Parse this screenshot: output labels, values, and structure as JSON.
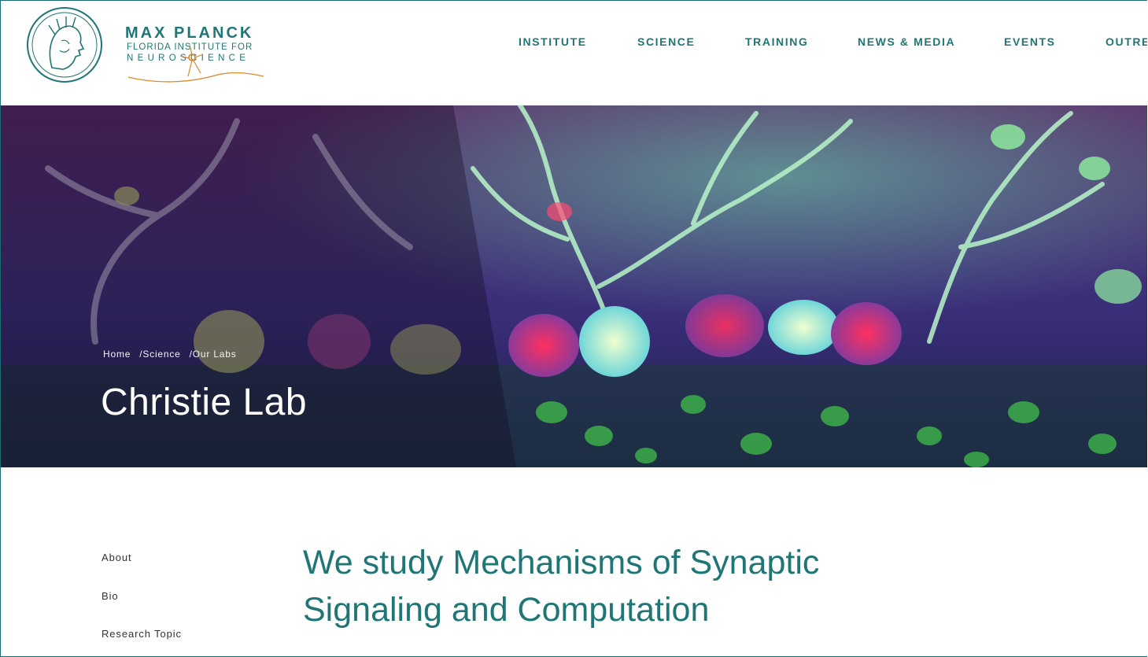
{
  "brand": {
    "title": "MAX PLANCK",
    "subtitle_line1": "FLORIDA INSTITUTE FOR",
    "subtitle_line2": "NEUROSCIENCE",
    "seal_icon": "minerva-seal-icon",
    "neuron_icon": "neuron-icon"
  },
  "nav": {
    "items": [
      "INSTITUTE",
      "SCIENCE",
      "TRAINING",
      "NEWS & MEDIA",
      "EVENTS",
      "OUTREA"
    ]
  },
  "breadcrumb": {
    "items": [
      "Home",
      "Science",
      "Our Labs"
    ],
    "separator": "/"
  },
  "hero": {
    "title": "Christie Lab"
  },
  "sidebar": {
    "items": [
      "About",
      "Bio",
      "Research Topic"
    ]
  },
  "main": {
    "headline": "We study Mechanisms of Synaptic Signaling and Computation"
  },
  "colors": {
    "brand_teal": "#1f7675",
    "neuron_orange": "#d98a2b"
  }
}
